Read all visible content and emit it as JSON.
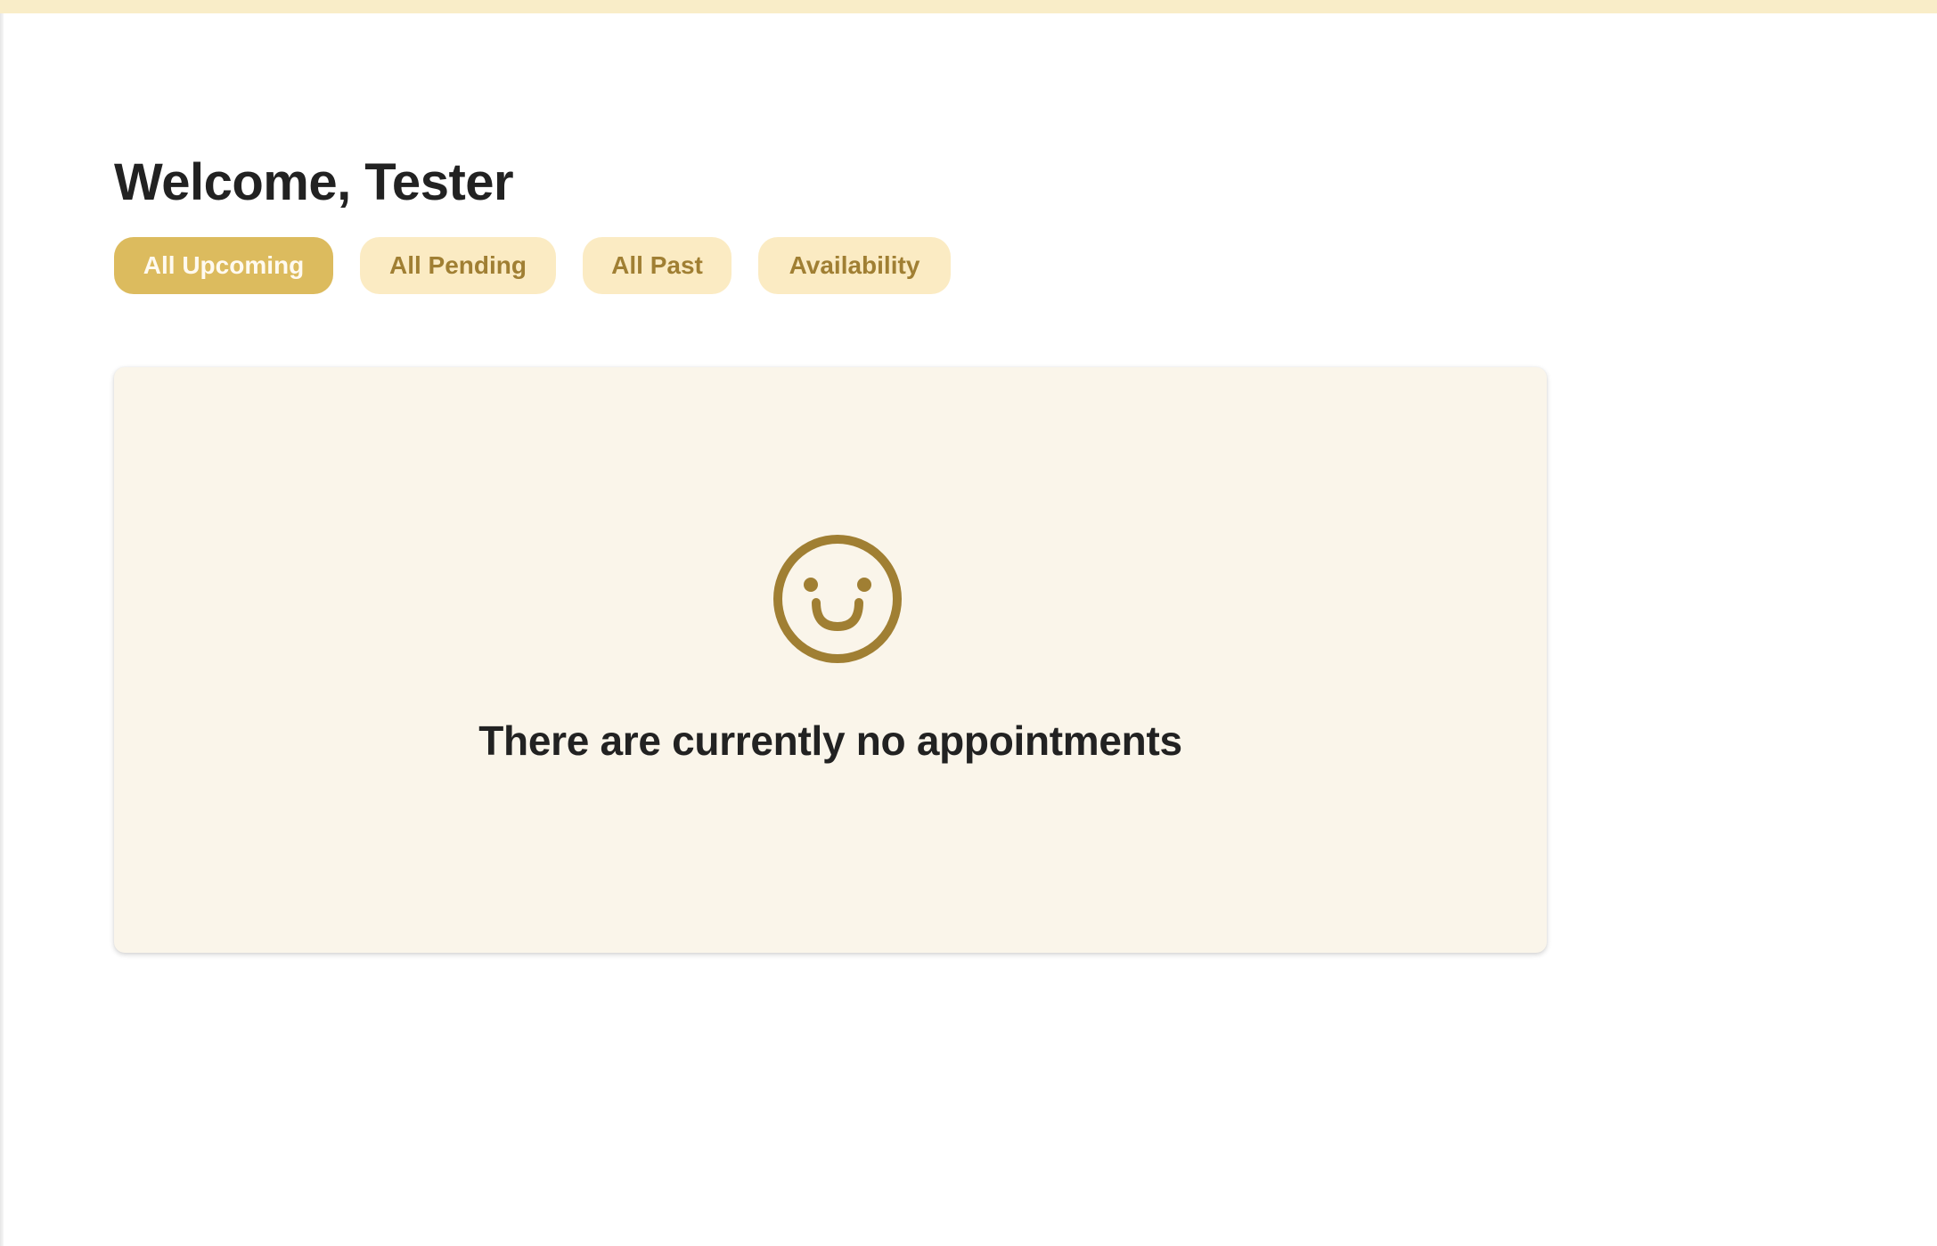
{
  "header": {
    "welcome_text": "Welcome, Tester"
  },
  "tabs": [
    {
      "label": "All Upcoming",
      "active": true
    },
    {
      "label": "All Pending",
      "active": false
    },
    {
      "label": "All Past",
      "active": false
    },
    {
      "label": "Availability",
      "active": false
    }
  ],
  "empty_state": {
    "icon": "smile-icon",
    "message": "There are currently no appointments"
  },
  "colors": {
    "top_bar": "#f9edc8",
    "active_tab_bg": "#dcbb5e",
    "inactive_tab_bg": "#fbebc3",
    "inactive_tab_text": "#a07f33",
    "card_bg": "#faf5ea",
    "icon": "#a07f33"
  }
}
